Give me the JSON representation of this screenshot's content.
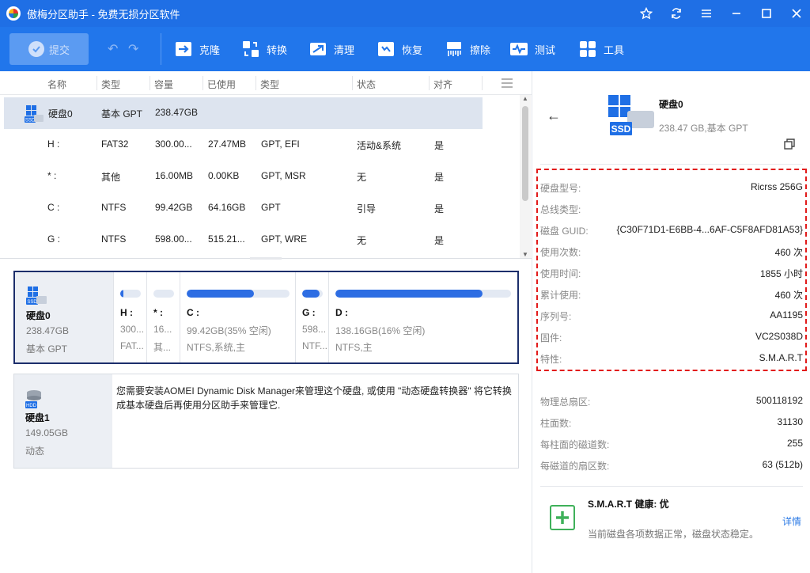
{
  "app": {
    "title": "傲梅分区助手 - 免费无损分区软件"
  },
  "toolbar": {
    "submit": "提交",
    "tools": [
      "克隆",
      "转换",
      "清理",
      "恢复",
      "擦除",
      "测试",
      "工具"
    ]
  },
  "table": {
    "headers": [
      "名称",
      "类型",
      "容量",
      "已使用",
      "类型",
      "状态",
      "对齐"
    ],
    "disk_row": {
      "name": "硬盘0",
      "type": "基本 GPT",
      "capacity": "238.47GB"
    },
    "rows": [
      {
        "name": "H :",
        "type": "FAT32",
        "capacity": "300.00...",
        "used": "27.47MB",
        "ptype": "GPT, EFI",
        "status": "活动&系统",
        "align": "是"
      },
      {
        "name": "* :",
        "type": "其他",
        "capacity": "16.00MB",
        "used": "0.00KB",
        "ptype": "GPT, MSR",
        "status": "无",
        "align": "是"
      },
      {
        "name": "C :",
        "type": "NTFS",
        "capacity": "99.42GB",
        "used": "64.16GB",
        "ptype": "GPT",
        "status": "引导",
        "align": "是"
      },
      {
        "name": "G :",
        "type": "NTFS",
        "capacity": "598.00...",
        "used": "515.21...",
        "ptype": "GPT, WRE",
        "status": "无",
        "align": "是"
      }
    ]
  },
  "disk0": {
    "badge": "SSD",
    "name": "硬盘0",
    "size": "238.47GB",
    "type": "基本 GPT",
    "partitions": [
      {
        "label": "H :",
        "size": "300...",
        "fs": "FAT...",
        "fill": 0.15
      },
      {
        "label": "* :",
        "size": "16...",
        "fs": "其...",
        "fill": 0.0
      },
      {
        "label": "C :",
        "size": "99.42GB(35% 空闲)",
        "fs": "NTFS,系统,主",
        "fill": 0.65
      },
      {
        "label": "G :",
        "size": "598...",
        "fs": "NTF...",
        "fill": 0.86
      },
      {
        "label": "D :",
        "size": "138.16GB(16% 空闲)",
        "fs": "NTFS,主",
        "fill": 0.84
      }
    ]
  },
  "disk1": {
    "badge": "HDD",
    "name": "硬盘1",
    "size": "149.05GB",
    "type": "动态",
    "message": "您需要安装AOMEI Dynamic Disk Manager来管理这个硬盘, 或使用 \"动态硬盘转换器\" 将它转换成基本硬盘后再使用分区助手来管理它."
  },
  "details": {
    "name": "硬盘0",
    "badge": "SSD",
    "sub": "238.47 GB,基本 GPT",
    "highlighted": [
      {
        "k": "硬盘型号:",
        "v": "Ricrss 256G"
      },
      {
        "k": "总线类型:",
        "v": ""
      },
      {
        "k": "磁盘 GUID:",
        "v": "{C30F71D1-E6BB-4...6AF-C5F8AFD81A53}"
      },
      {
        "k": "使用次数:",
        "v": "460 次"
      },
      {
        "k": "使用时间:",
        "v": "1855 小时"
      },
      {
        "k": "累计使用:",
        "v": "460 次"
      },
      {
        "k": "序列号:",
        "v": "AA1195"
      },
      {
        "k": "固件:",
        "v": "VC2S038D"
      },
      {
        "k": "特性:",
        "v": "S.M.A.R.T"
      }
    ],
    "geometry": [
      {
        "k": "物理总扇区:",
        "v": "500118192"
      },
      {
        "k": "柱面数:",
        "v": "31130"
      },
      {
        "k": "每柱面的磁道数:",
        "v": "255"
      },
      {
        "k": "每磁道的扇区数:",
        "v": "63 (512b)"
      }
    ],
    "smart": {
      "title": "S.M.A.R.T 健康: 优",
      "desc": "当前磁盘各项数据正常，磁盘状态稳定。",
      "link": "详情"
    }
  },
  "colors": {
    "titlebar": "#1f6fe5",
    "toolbar": "#2176eb",
    "accent": "#2d6de3",
    "highlight": "#e21b1b",
    "smart_ok": "#3fb15a"
  }
}
